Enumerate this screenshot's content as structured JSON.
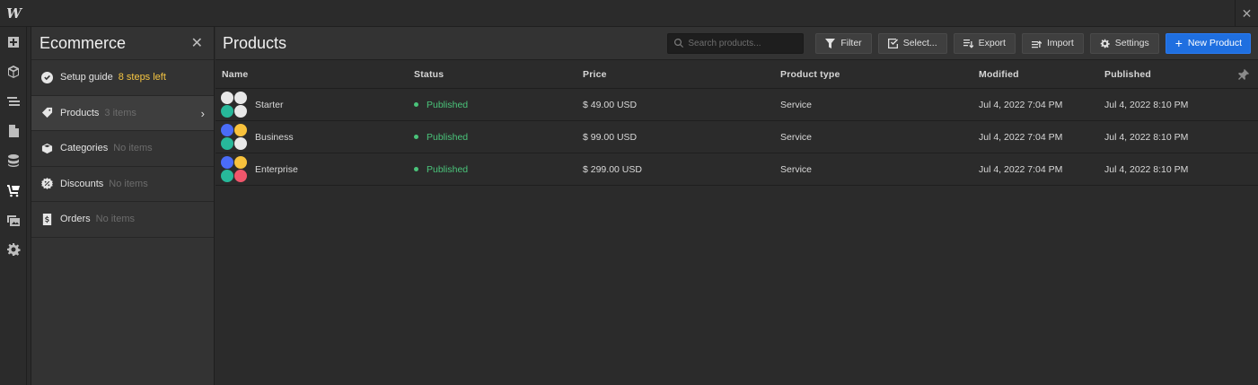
{
  "app": {
    "logo": "W",
    "close": "✕"
  },
  "rail": [
    "add-icon",
    "box-icon",
    "navigator-icon",
    "pages-icon",
    "database-icon",
    "cart-icon",
    "assets-icon",
    "settings-icon"
  ],
  "panel": {
    "title": "Ecommerce",
    "close": "✕",
    "items": [
      {
        "label": "Setup guide",
        "meta": "8 steps left",
        "icon": "check-circle-icon"
      },
      {
        "label": "Products",
        "meta": "3 items",
        "icon": "tag-icon"
      },
      {
        "label": "Categories",
        "meta": "No items",
        "icon": "category-icon"
      },
      {
        "label": "Discounts",
        "meta": "No items",
        "icon": "discount-icon"
      },
      {
        "label": "Orders",
        "meta": "No items",
        "icon": "receipt-icon"
      }
    ],
    "chevron": "›"
  },
  "main": {
    "title": "Products",
    "search_placeholder": "Search products...",
    "buttons": {
      "filter": "Filter",
      "select": "Select...",
      "export": "Export",
      "import": "Import",
      "settings": "Settings",
      "new_product": "New Product",
      "plus": "+"
    }
  },
  "table": {
    "columns": [
      "Name",
      "Status",
      "Price",
      "Product type",
      "Modified",
      "Published"
    ],
    "rows": [
      {
        "name": "Starter",
        "status": "Published",
        "price": "$ 49.00 USD",
        "type": "Service",
        "modified": "Jul 4, 2022 7:04 PM",
        "published": "Jul 4, 2022 8:10 PM",
        "thumb": [
          "#e8e8e8",
          "#e8e8e8",
          "#27b89a",
          "#e8e8e8"
        ]
      },
      {
        "name": "Business",
        "status": "Published",
        "price": "$ 99.00 USD",
        "type": "Service",
        "modified": "Jul 4, 2022 7:04 PM",
        "published": "Jul 4, 2022 8:10 PM",
        "thumb": [
          "#4a6cf7",
          "#f8c23c",
          "#27b89a",
          "#e8e8e8"
        ]
      },
      {
        "name": "Enterprise",
        "status": "Published",
        "price": "$ 299.00 USD",
        "type": "Service",
        "modified": "Jul 4, 2022 7:04 PM",
        "published": "Jul 4, 2022 8:10 PM",
        "thumb": [
          "#4a6cf7",
          "#f8c23c",
          "#27b89a",
          "#f0566b"
        ]
      }
    ]
  },
  "colors": {
    "accent": "#1f6fe0",
    "published": "#4ac47a",
    "warn": "#f5c542"
  }
}
